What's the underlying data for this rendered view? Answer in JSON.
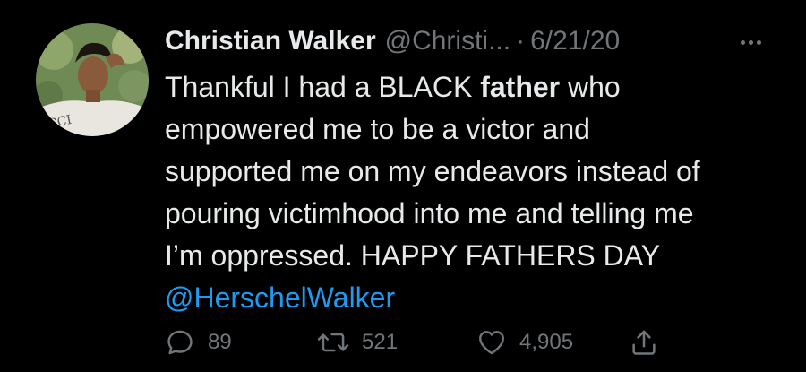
{
  "tweet": {
    "author_name": "Christian Walker",
    "handle": "@Christi...",
    "separator": "·",
    "date": "6/21/20",
    "more_icon": "more-horizontal-icon",
    "avatar_shirt_text": "UCCI",
    "text": {
      "line1_before": "Thankful I had a BLACK ",
      "line1_bold": "father",
      "line1_after": " who",
      "line2": "empowered me to be a victor and",
      "line3": "supported me on my endeavors instead of",
      "line4": "pouring victimhood into me and telling me",
      "line5": "I’m oppressed. HAPPY FATHERS DAY",
      "mention": "@HerschelWalker"
    },
    "actions": {
      "replies": "89",
      "retweets": "521",
      "likes": "4,905"
    }
  },
  "colors": {
    "background": "#000000",
    "text": "#e7e9ea",
    "secondary": "#71767b",
    "link": "#1d9bf0"
  }
}
